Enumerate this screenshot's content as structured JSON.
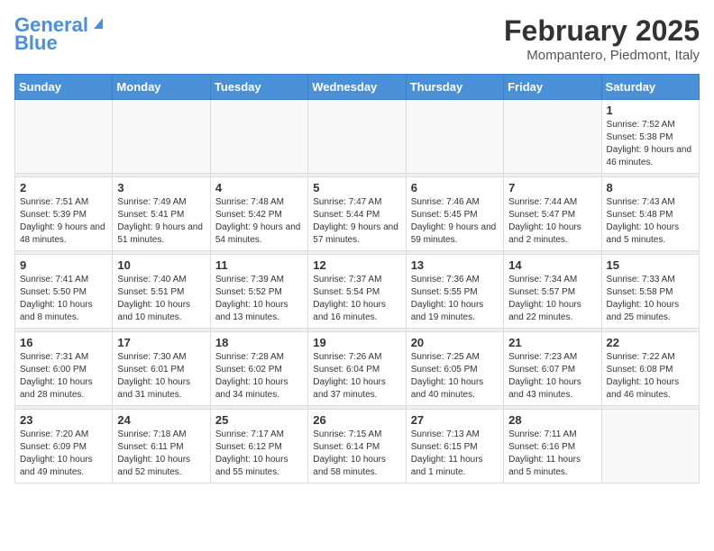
{
  "header": {
    "logo_line1": "General",
    "logo_line2": "Blue",
    "month": "February 2025",
    "location": "Mompantero, Piedmont, Italy"
  },
  "days_of_week": [
    "Sunday",
    "Monday",
    "Tuesday",
    "Wednesday",
    "Thursday",
    "Friday",
    "Saturday"
  ],
  "weeks": [
    [
      {
        "day": "",
        "info": ""
      },
      {
        "day": "",
        "info": ""
      },
      {
        "day": "",
        "info": ""
      },
      {
        "day": "",
        "info": ""
      },
      {
        "day": "",
        "info": ""
      },
      {
        "day": "",
        "info": ""
      },
      {
        "day": "1",
        "info": "Sunrise: 7:52 AM\nSunset: 5:38 PM\nDaylight: 9 hours and 46 minutes."
      }
    ],
    [
      {
        "day": "2",
        "info": "Sunrise: 7:51 AM\nSunset: 5:39 PM\nDaylight: 9 hours and 48 minutes."
      },
      {
        "day": "3",
        "info": "Sunrise: 7:49 AM\nSunset: 5:41 PM\nDaylight: 9 hours and 51 minutes."
      },
      {
        "day": "4",
        "info": "Sunrise: 7:48 AM\nSunset: 5:42 PM\nDaylight: 9 hours and 54 minutes."
      },
      {
        "day": "5",
        "info": "Sunrise: 7:47 AM\nSunset: 5:44 PM\nDaylight: 9 hours and 57 minutes."
      },
      {
        "day": "6",
        "info": "Sunrise: 7:46 AM\nSunset: 5:45 PM\nDaylight: 9 hours and 59 minutes."
      },
      {
        "day": "7",
        "info": "Sunrise: 7:44 AM\nSunset: 5:47 PM\nDaylight: 10 hours and 2 minutes."
      },
      {
        "day": "8",
        "info": "Sunrise: 7:43 AM\nSunset: 5:48 PM\nDaylight: 10 hours and 5 minutes."
      }
    ],
    [
      {
        "day": "9",
        "info": "Sunrise: 7:41 AM\nSunset: 5:50 PM\nDaylight: 10 hours and 8 minutes."
      },
      {
        "day": "10",
        "info": "Sunrise: 7:40 AM\nSunset: 5:51 PM\nDaylight: 10 hours and 10 minutes."
      },
      {
        "day": "11",
        "info": "Sunrise: 7:39 AM\nSunset: 5:52 PM\nDaylight: 10 hours and 13 minutes."
      },
      {
        "day": "12",
        "info": "Sunrise: 7:37 AM\nSunset: 5:54 PM\nDaylight: 10 hours and 16 minutes."
      },
      {
        "day": "13",
        "info": "Sunrise: 7:36 AM\nSunset: 5:55 PM\nDaylight: 10 hours and 19 minutes."
      },
      {
        "day": "14",
        "info": "Sunrise: 7:34 AM\nSunset: 5:57 PM\nDaylight: 10 hours and 22 minutes."
      },
      {
        "day": "15",
        "info": "Sunrise: 7:33 AM\nSunset: 5:58 PM\nDaylight: 10 hours and 25 minutes."
      }
    ],
    [
      {
        "day": "16",
        "info": "Sunrise: 7:31 AM\nSunset: 6:00 PM\nDaylight: 10 hours and 28 minutes."
      },
      {
        "day": "17",
        "info": "Sunrise: 7:30 AM\nSunset: 6:01 PM\nDaylight: 10 hours and 31 minutes."
      },
      {
        "day": "18",
        "info": "Sunrise: 7:28 AM\nSunset: 6:02 PM\nDaylight: 10 hours and 34 minutes."
      },
      {
        "day": "19",
        "info": "Sunrise: 7:26 AM\nSunset: 6:04 PM\nDaylight: 10 hours and 37 minutes."
      },
      {
        "day": "20",
        "info": "Sunrise: 7:25 AM\nSunset: 6:05 PM\nDaylight: 10 hours and 40 minutes."
      },
      {
        "day": "21",
        "info": "Sunrise: 7:23 AM\nSunset: 6:07 PM\nDaylight: 10 hours and 43 minutes."
      },
      {
        "day": "22",
        "info": "Sunrise: 7:22 AM\nSunset: 6:08 PM\nDaylight: 10 hours and 46 minutes."
      }
    ],
    [
      {
        "day": "23",
        "info": "Sunrise: 7:20 AM\nSunset: 6:09 PM\nDaylight: 10 hours and 49 minutes."
      },
      {
        "day": "24",
        "info": "Sunrise: 7:18 AM\nSunset: 6:11 PM\nDaylight: 10 hours and 52 minutes."
      },
      {
        "day": "25",
        "info": "Sunrise: 7:17 AM\nSunset: 6:12 PM\nDaylight: 10 hours and 55 minutes."
      },
      {
        "day": "26",
        "info": "Sunrise: 7:15 AM\nSunset: 6:14 PM\nDaylight: 10 hours and 58 minutes."
      },
      {
        "day": "27",
        "info": "Sunrise: 7:13 AM\nSunset: 6:15 PM\nDaylight: 11 hours and 1 minute."
      },
      {
        "day": "28",
        "info": "Sunrise: 7:11 AM\nSunset: 6:16 PM\nDaylight: 11 hours and 5 minutes."
      },
      {
        "day": "",
        "info": ""
      }
    ]
  ]
}
